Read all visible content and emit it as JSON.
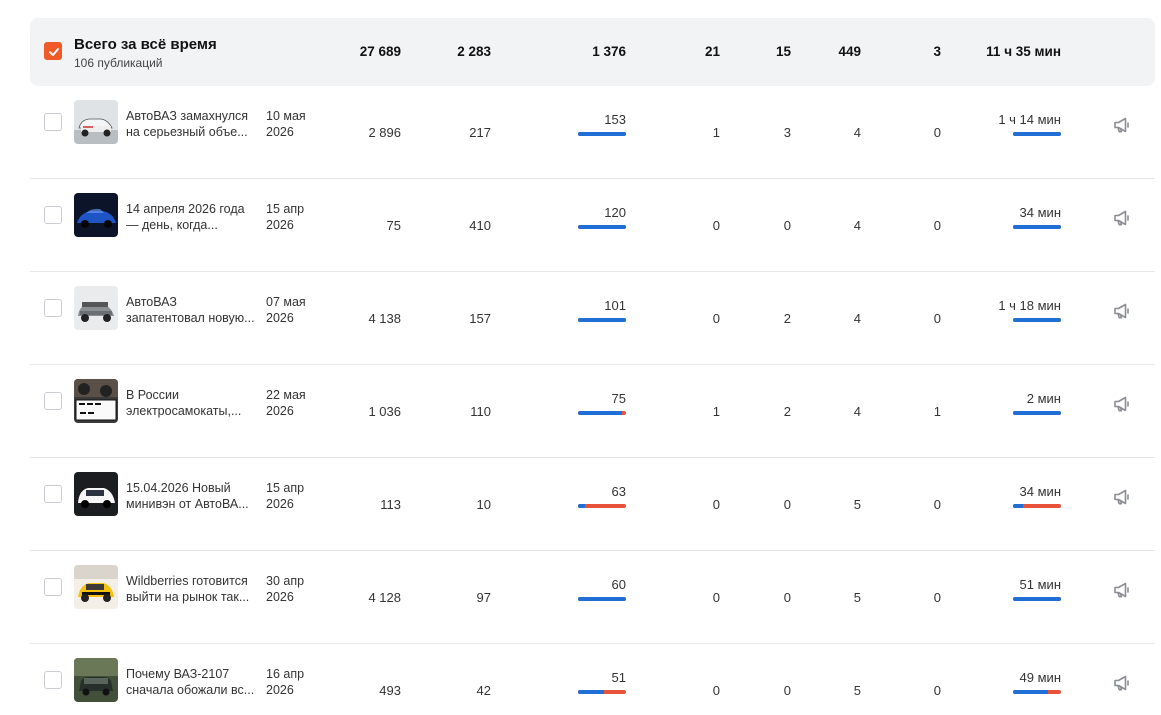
{
  "total": {
    "checked": true,
    "title": "Всего за всё время",
    "subtitle": "106 публикаций",
    "c1": "27 689",
    "c2": "2 283",
    "c3": "1 376",
    "c4": "21",
    "c5": "15",
    "c6": "449",
    "c7": "3",
    "c8": "11 ч 35 мин"
  },
  "rows": [
    {
      "title_l1": "АвтоВАЗ замахнулся",
      "title_l2": "на серьезный объе...",
      "date_l1": "10 мая",
      "date_l2": "2026",
      "c1": "2 896",
      "c2": "217",
      "c3": "153",
      "c3_fill": 1.0,
      "c4": "1",
      "c5": "3",
      "c6": "4",
      "c7": "0",
      "c8": "1 ч 14 мин",
      "c8_fill": 1.0,
      "thumb": "white-suv"
    },
    {
      "title_l1": "14 апреля 2026 года",
      "title_l2": "— день, когда...",
      "date_l1": "15 апр",
      "date_l2": "2026",
      "c1": "75",
      "c2": "410",
      "c3": "120",
      "c3_fill": 1.0,
      "c4": "0",
      "c5": "0",
      "c6": "4",
      "c7": "0",
      "c8": "34 мин",
      "c8_fill": 1.0,
      "thumb": "blue-car"
    },
    {
      "title_l1": "АвтоВАЗ",
      "title_l2": "запатентовал новую...",
      "date_l1": "07 мая",
      "date_l2": "2026",
      "c1": "4 138",
      "c2": "157",
      "c3": "101",
      "c3_fill": 1.0,
      "c4": "0",
      "c5": "2",
      "c6": "4",
      "c7": "0",
      "c8": "1 ч 18 мин",
      "c8_fill": 1.0,
      "thumb": "grey-suv"
    },
    {
      "title_l1": "В России",
      "title_l2": "электросамокаты,...",
      "date_l1": "22 мая",
      "date_l2": "2026",
      "c1": "1 036",
      "c2": "110",
      "c3": "75",
      "c3_fill": 0.92,
      "c4": "1",
      "c5": "2",
      "c6": "4",
      "c7": "1",
      "c8": "2 мин",
      "c8_fill": 1.0,
      "thumb": "plate"
    },
    {
      "title_l1": "15.04.2026 Новый",
      "title_l2": "минивэн от АвтоВА...",
      "date_l1": "15 апр",
      "date_l2": "2026",
      "c1": "113",
      "c2": "10",
      "c3": "63",
      "c3_fill": 0.15,
      "c4": "0",
      "c5": "0",
      "c6": "5",
      "c7": "0",
      "c8": "34 мин",
      "c8_fill": 0.2,
      "thumb": "white-van"
    },
    {
      "title_l1": "Wildberries готовится",
      "title_l2": "выйти на рынок так...",
      "date_l1": "30 апр",
      "date_l2": "2026",
      "c1": "4 128",
      "c2": "97",
      "c3": "60",
      "c3_fill": 1.0,
      "c4": "0",
      "c5": "0",
      "c6": "5",
      "c7": "0",
      "c8": "51 мин",
      "c8_fill": 1.0,
      "thumb": "yellow-taxi"
    },
    {
      "title_l1": "Почему ВАЗ-2107",
      "title_l2": "сначала обожали вс...",
      "date_l1": "16 апр",
      "date_l2": "2026",
      "c1": "493",
      "c2": "42",
      "c3": "51",
      "c3_fill": 0.55,
      "c4": "0",
      "c5": "0",
      "c6": "5",
      "c7": "0",
      "c8": "49 мин",
      "c8_fill": 0.72,
      "thumb": "old-car"
    }
  ],
  "icons": {
    "check": "check-icon",
    "promote": "megaphone-icon"
  },
  "colors": {
    "accent": "#f05a28",
    "bar_blue": "#1f6fd6",
    "bar_red": "#e8513a"
  }
}
